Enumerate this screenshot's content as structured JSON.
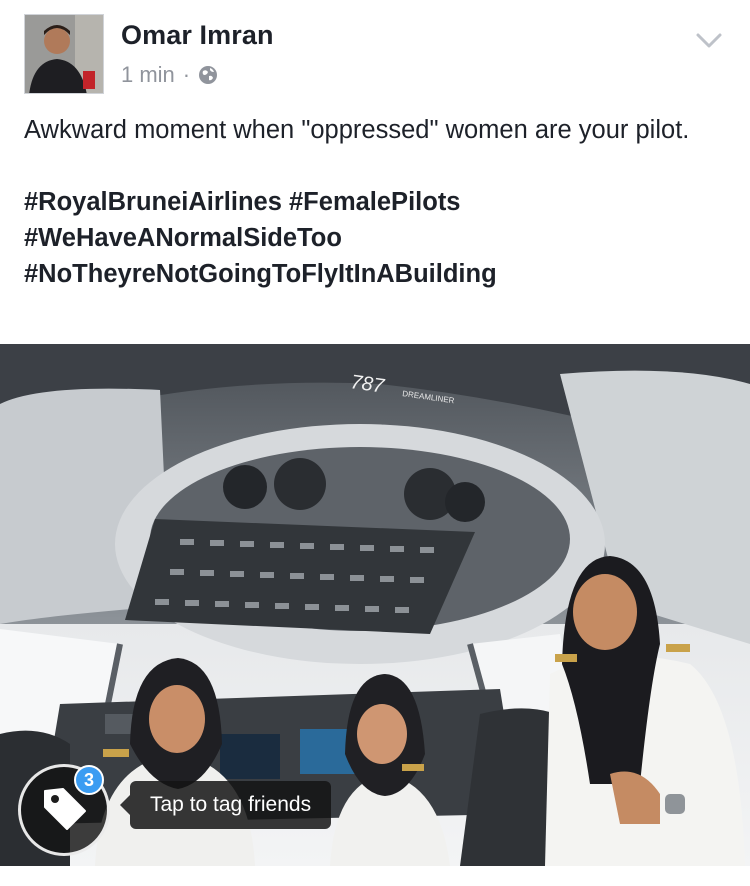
{
  "post": {
    "author": "Omar Imran",
    "time": "1 min",
    "separator": "·",
    "privacy_icon": "globe-icon",
    "menu_icon": "chevron-down-icon",
    "text_line": "Awkward moment when \"oppressed\" women are your pilot.",
    "hashtags": [
      "#RoyalBruneiAirlines #FemalePilots",
      "#WeHaveANormalSideToo",
      "#NoTheyreNotGoingToFlyItInABuilding"
    ]
  },
  "photo": {
    "panel_label": "787",
    "panel_sublabel": "DREAMLINER"
  },
  "tagging": {
    "icon": "tag-icon",
    "count": "3",
    "tooltip": "Tap to tag friends"
  },
  "colors": {
    "text": "#1d2129",
    "meta": "#90949c",
    "badge": "#3b9cf2"
  }
}
